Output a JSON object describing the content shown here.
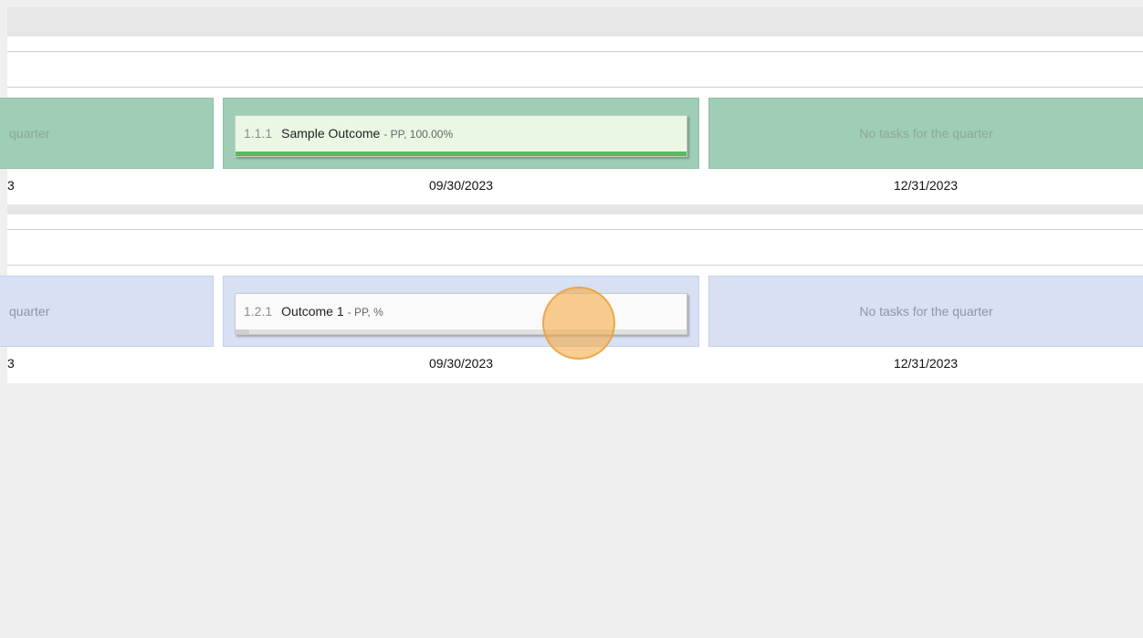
{
  "colors": {
    "page_background": "#efefef",
    "green_row": "#9fcdb6",
    "blue_row": "#d7e1f3",
    "progress_complete": "#5cb85c",
    "cursor_highlight": "#f5aa46"
  },
  "rows": [
    {
      "left_cell_text": "quarter",
      "left_date": "3",
      "outcome": {
        "number": "1.1.1",
        "name": "Sample Outcome",
        "meta": "- PP, 100.00%",
        "progress_fraction": 1.0
      },
      "q3_date": "09/30/2023",
      "right_cell_text": "No tasks for the quarter",
      "q4_date": "12/31/2023"
    },
    {
      "left_cell_text": "quarter",
      "left_date": "3",
      "outcome": {
        "number": "1.2.1",
        "name": "Outcome 1",
        "meta": "- PP, %",
        "progress_fraction": 0.03
      },
      "q3_date": "09/30/2023",
      "right_cell_text": "No tasks for the quarter",
      "q4_date": "12/31/2023"
    }
  ]
}
